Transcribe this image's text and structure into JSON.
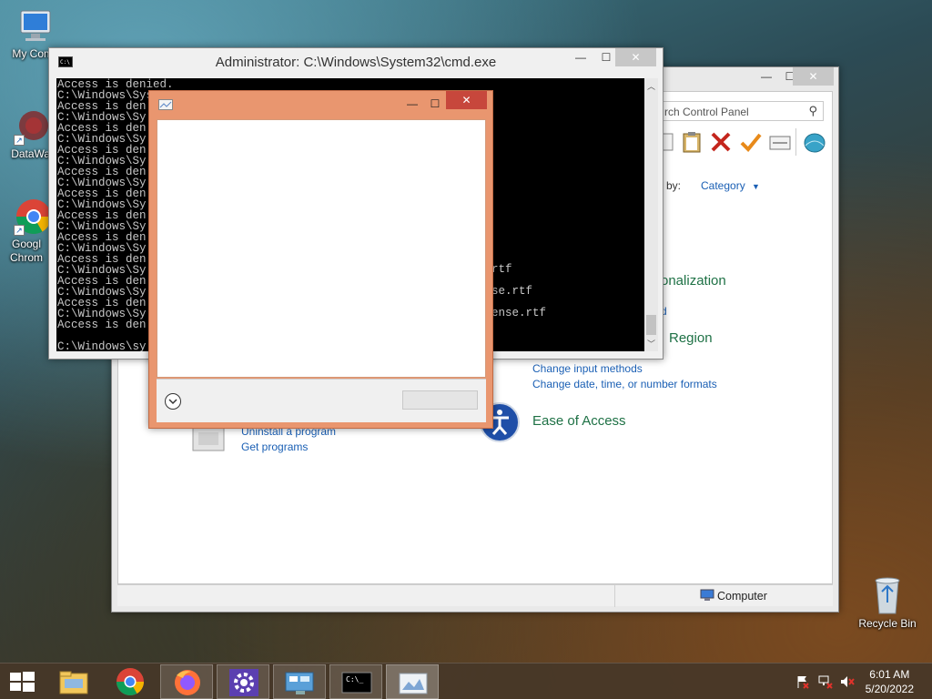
{
  "desktop": {
    "icons": [
      {
        "label": "My Comp"
      },
      {
        "label": "DataWag"
      },
      {
        "label": "Googl Chrom"
      },
      {
        "label": "Recycle Bin"
      }
    ]
  },
  "cmd_window": {
    "title": "Administrator: C:\\Windows\\System32\\cmd.exe",
    "lines": [
      "Access is denied.",
      "C:\\Windows\\Sys",
      "Access is den",
      "C:\\Windows\\Sy",
      "Access is den",
      "C:\\Windows\\Sy",
      "Access is den",
      "C:\\Windows\\Sy",
      "Access is den",
      "C:\\Windows\\Sy",
      "Access is den",
      "C:\\Windows\\Sy",
      "Access is den",
      "C:\\Windows\\Sy",
      "Access is den",
      "C:\\Windows\\Sy",
      "Access is den",
      "C:\\Windows\\Sy",
      "Access is den",
      "C:\\Windows\\Sy",
      "Access is den",
      "C:\\Windows\\Sy",
      "Access is den",
      "",
      "C:\\Windows\\sy"
    ],
    "right_fragments": [
      "rtf",
      "se.rtf",
      "ense.rtf"
    ]
  },
  "control_panel": {
    "search_placeholder": "rch Control Panel",
    "view_by_label": "w by:",
    "view_by_value": "Category",
    "categories": {
      "appearance_fragment": "onalization",
      "appearance_link_fragment": "d",
      "clock_region_fragment": "Region",
      "clock_links": [
        "Change input methods",
        "Change date, time, or number formats"
      ],
      "ease_of_access": "Ease of Access",
      "programs_links": [
        "Uninstall a program",
        "Get programs"
      ]
    },
    "status_computer": "Computer"
  },
  "dialog": {
    "title": ""
  },
  "taskbar": {
    "time": "6:01 AM",
    "date": "5/20/2022"
  },
  "colors": {
    "dialog_frame": "#e9966f",
    "link_blue": "#1a5fb4",
    "category_green": "#1e7145",
    "taskbar": "#46372a"
  }
}
